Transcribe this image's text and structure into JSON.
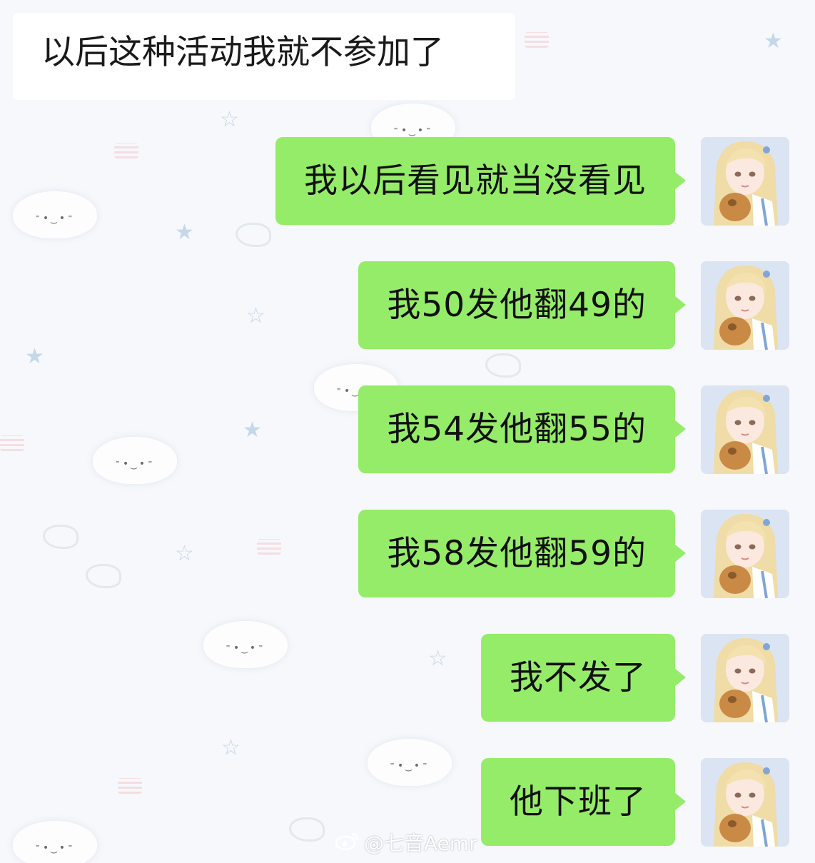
{
  "incoming_message": {
    "text": "以后这种活动我就不参加了"
  },
  "outgoing_messages": [
    {
      "text": "我以后看见就当没看见"
    },
    {
      "text": "我50发他翻49的"
    },
    {
      "text": "我54发他翻55的"
    },
    {
      "text": "我58发他翻59的"
    },
    {
      "text": "我不发了"
    },
    {
      "text": "他下班了"
    }
  ],
  "watermark": {
    "icon": "weibo-icon",
    "text": "@七音Aemr"
  },
  "colors": {
    "outgoing_bubble": "#95ec69",
    "incoming_bubble": "#ffffff",
    "text": "#111111"
  }
}
